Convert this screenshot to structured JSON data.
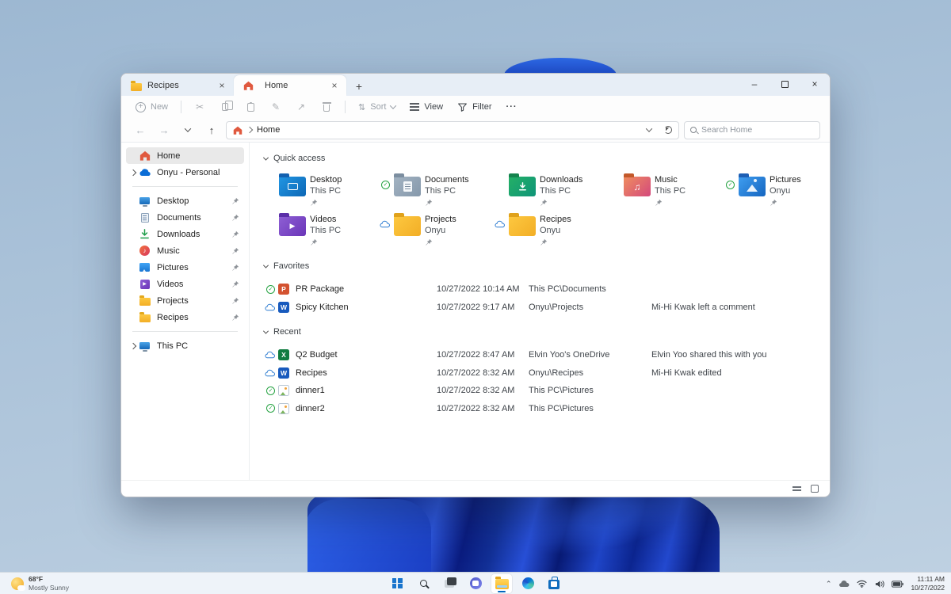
{
  "window": {
    "tabs": [
      {
        "label": "Recipes"
      },
      {
        "label": "Home"
      }
    ],
    "new_tab": "+",
    "controls": {
      "minimize": "–",
      "close": "×"
    },
    "toolbar": {
      "new": "New",
      "sort": "Sort",
      "view": "View",
      "filter": "Filter",
      "more": "···"
    },
    "address": {
      "path": "Home",
      "search_placeholder": "Search Home"
    },
    "sidebar": {
      "home": "Home",
      "onedrive": "Onyu - Personal",
      "pinned": [
        {
          "label": "Desktop"
        },
        {
          "label": "Documents"
        },
        {
          "label": "Downloads"
        },
        {
          "label": "Music"
        },
        {
          "label": "Pictures"
        },
        {
          "label": "Videos"
        },
        {
          "label": "Projects"
        },
        {
          "label": "Recipes"
        }
      ],
      "this_pc": "This PC"
    },
    "quick_access": {
      "title": "Quick access",
      "tiles": [
        {
          "name": "Desktop",
          "location": "This PC",
          "badge": "",
          "icon": "desktop-folder-icon"
        },
        {
          "name": "Documents",
          "location": "This PC",
          "badge": "synced",
          "icon": "documents-folder-icon"
        },
        {
          "name": "Downloads",
          "location": "This PC",
          "badge": "",
          "icon": "downloads-folder-icon"
        },
        {
          "name": "Music",
          "location": "This PC",
          "badge": "",
          "icon": "music-folder-icon"
        },
        {
          "name": "Pictures",
          "location": "Onyu",
          "badge": "synced",
          "icon": "pictures-folder-icon"
        },
        {
          "name": "Videos",
          "location": "This PC",
          "badge": "",
          "icon": "videos-folder-icon"
        },
        {
          "name": "Projects",
          "location": "Onyu",
          "badge": "cloud",
          "icon": "folder-icon"
        },
        {
          "name": "Recipes",
          "location": "Onyu",
          "badge": "cloud",
          "icon": "folder-icon"
        }
      ]
    },
    "favorites": {
      "title": "Favorites",
      "rows": [
        {
          "name": "PR Package",
          "date": "10/27/2022 10:14 AM",
          "location": "This PC\\Documents",
          "note": "",
          "badge": "synced",
          "filetype": "powerpoint"
        },
        {
          "name": "Spicy Kitchen",
          "date": "10/27/2022 9:17 AM",
          "location": "Onyu\\Projects",
          "note": "Mi-Hi Kwak left a comment",
          "badge": "cloud",
          "filetype": "word"
        }
      ]
    },
    "recent": {
      "title": "Recent",
      "rows": [
        {
          "name": "Q2 Budget",
          "date": "10/27/2022 8:47 AM",
          "location": "Elvin Yoo's OneDrive",
          "note": "Elvin Yoo shared this with you",
          "badge": "cloud",
          "filetype": "excel"
        },
        {
          "name": "Recipes",
          "date": "10/27/2022 8:32 AM",
          "location": "Onyu\\Recipes",
          "note": "Mi-Hi Kwak edited",
          "badge": "cloud",
          "filetype": "word"
        },
        {
          "name": "dinner1",
          "date": "10/27/2022 8:32 AM",
          "location": "This PC\\Pictures",
          "note": "",
          "badge": "synced",
          "filetype": "image"
        },
        {
          "name": "dinner2",
          "date": "10/27/2022 8:32 AM",
          "location": "This PC\\Pictures",
          "note": "",
          "badge": "synced",
          "filetype": "image"
        }
      ]
    },
    "statusbar": {
      "icons": [
        "details-view-icon",
        "large-icons-view-icon"
      ]
    }
  },
  "taskbar": {
    "weather": {
      "temp": "68°F",
      "condition": "Mostly Sunny"
    },
    "icons": [
      "start-icon",
      "search-icon",
      "task-view-icon",
      "chat-icon",
      "file-explorer-icon",
      "edge-icon",
      "store-icon"
    ],
    "tray": {
      "icons": [
        "tray-chevron-icon",
        "onedrive-icon",
        "wifi-icon",
        "volume-icon",
        "battery-icon"
      ],
      "time": "11:11 AM",
      "date": "10/27/2022"
    }
  },
  "colors": {
    "accent": "#0067c0",
    "folder_yellow": "#fcbf2d",
    "bloom_blue": "#1a3db8",
    "sky": "#aac2d8"
  }
}
